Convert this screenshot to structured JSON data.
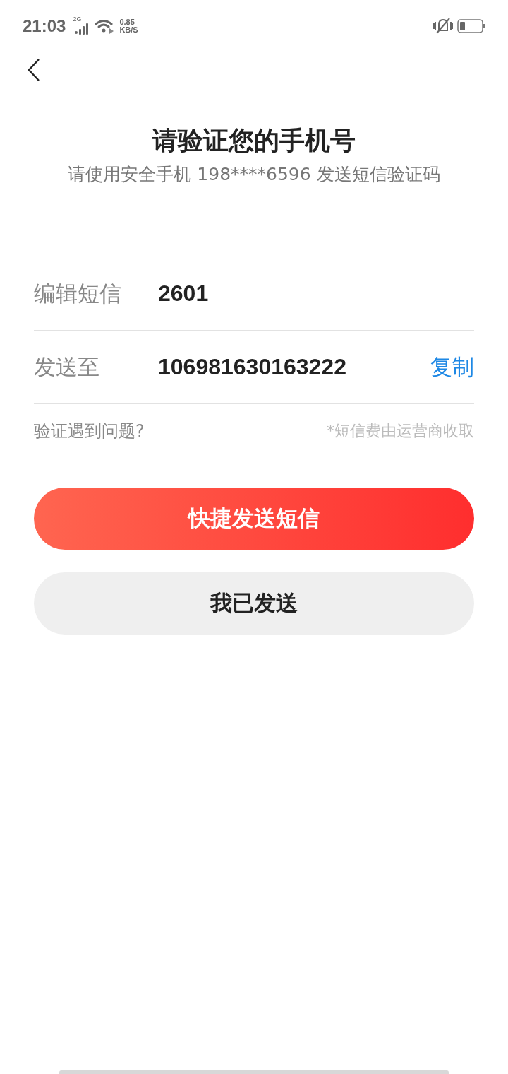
{
  "status_bar": {
    "time": "21:03",
    "network": "2G",
    "speed_value": "0.85",
    "speed_unit": "KB/S"
  },
  "title": "请验证您的手机号",
  "subtitle": "请使用安全手机 198****6596 发送短信验证码",
  "rows": [
    {
      "label": "编辑短信",
      "value": "2601"
    },
    {
      "label": "发送至",
      "value": "106981630163222",
      "action": "复制"
    }
  ],
  "help_link": "验证遇到问题?",
  "fee_note": "*短信费由运营商收取",
  "buttons": [
    {
      "label": "快捷发送短信",
      "kind": "primary"
    },
    {
      "label": "我已发送",
      "kind": "secondary"
    }
  ]
}
